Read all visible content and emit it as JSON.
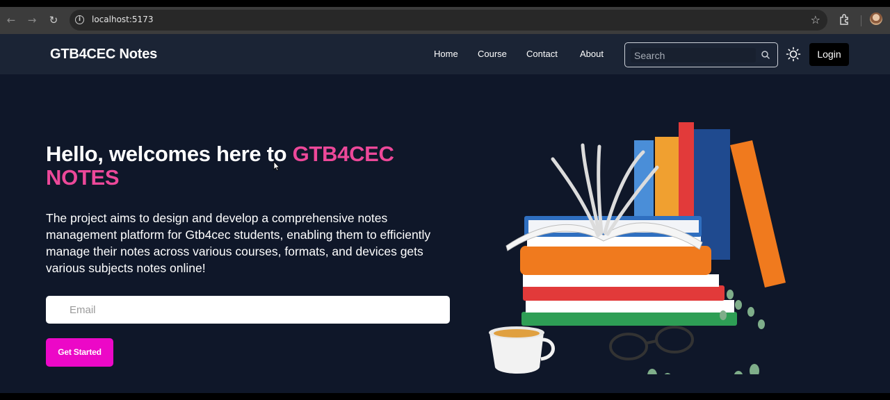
{
  "browser": {
    "url": "localhost:5173"
  },
  "navbar": {
    "brand": "GTB4CEC Notes",
    "links": [
      "Home",
      "Course",
      "Contact",
      "About"
    ],
    "search_placeholder": "Search",
    "login_label": "Login"
  },
  "hero": {
    "title_prefix": "Hello, welcomes here to ",
    "title_highlight": "GTB4CEC NOTES",
    "description": "The project aims to design and develop a comprehensive notes management platform for Gtb4cec students, enabling them to efficiently manage their notes across various courses, formats, and devices gets various subjects notes online!",
    "email_placeholder": "Email",
    "cta_label": "Get Started"
  },
  "colors": {
    "background": "#0f1729",
    "navbar": "#1b2435",
    "highlight": "#ec4899",
    "cta": "#ec08c7"
  }
}
